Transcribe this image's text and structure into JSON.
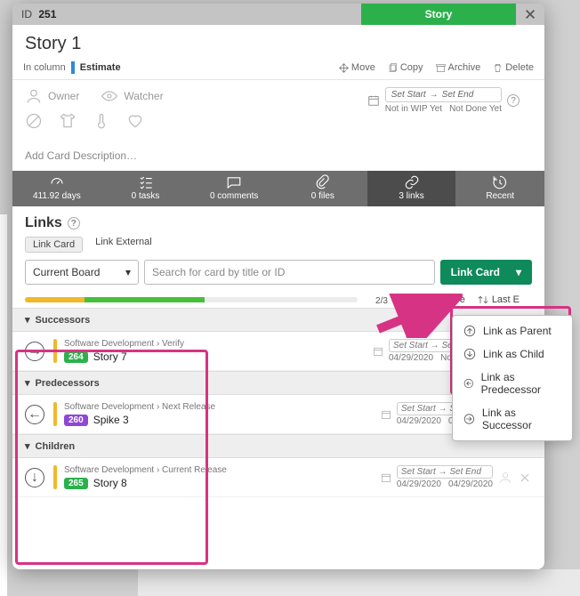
{
  "header": {
    "id_label": "ID",
    "id": "251",
    "type": "Story"
  },
  "title": "Story 1",
  "column_line": {
    "prefix": "In column",
    "value": "Estimate"
  },
  "actions": {
    "move": "Move",
    "copy": "Copy",
    "archive": "Archive",
    "delete": "Delete"
  },
  "people": {
    "owner": "Owner",
    "watcher": "Watcher"
  },
  "dates": {
    "set_start": "Set Start",
    "set_end": "Set End",
    "wip": "Not in WIP Yet",
    "done": "Not Done Yet"
  },
  "desc_placeholder": "Add Card Description…",
  "tabs": {
    "cycle": "411.92 days",
    "tasks": "0 tasks",
    "comments": "0 comments",
    "files": "0 files",
    "links": "3 links",
    "recent": "Recent"
  },
  "section_title": "Links",
  "link_mode": {
    "card": "Link Card",
    "external": "Link External"
  },
  "board_select": "Current Board",
  "search_ph": "Search for card by title or ID",
  "link_btn": "Link Card",
  "progress": "2/3",
  "sorters": {
    "type": "Link Type",
    "last": "Last E"
  },
  "groups": {
    "succ": "Successors",
    "pred": "Predecessors",
    "child": "Children"
  },
  "cards": {
    "c1": {
      "crumb": "Software Development › Verify",
      "badge": "264",
      "title": "Story 7",
      "d1": "04/29/2020",
      "d2": "Not Done Yet"
    },
    "c2": {
      "crumb": "Software Development › Next Release",
      "badge": "260",
      "title": "Spike 3",
      "d1": "04/29/2020",
      "d2": "04/29/2020"
    },
    "c3": {
      "crumb": "Software Development › Current Release",
      "badge": "265",
      "title": "Story 8",
      "d1": "04/29/2020",
      "d2": "04/29/2020"
    }
  },
  "row_dates": {
    "ss": "Set Start",
    "se": "Set End"
  },
  "menu": {
    "parent": "Link as Parent",
    "child": "Link as Child",
    "pred": "Link as Predecessor",
    "succ": "Link as Successor"
  }
}
